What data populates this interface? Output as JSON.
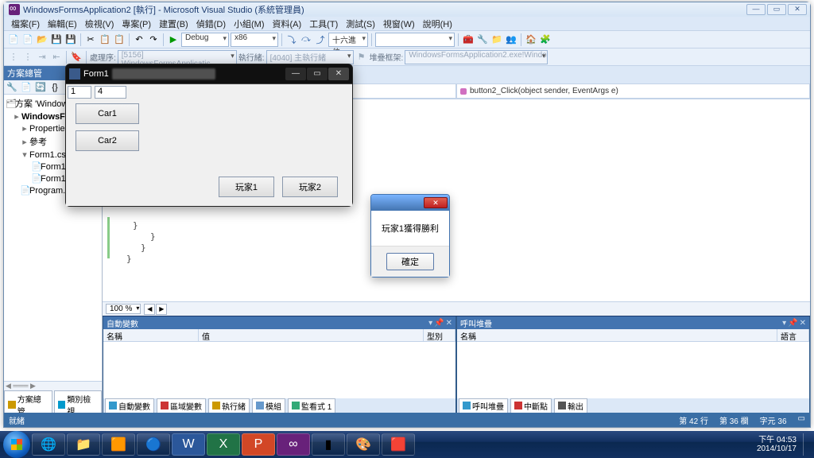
{
  "title": "WindowsFormsApplication2 [執行] - Microsoft Visual Studio (系統管理員)",
  "menu": [
    "檔案(F)",
    "編輯(E)",
    "檢視(V)",
    "專案(P)",
    "建置(B)",
    "偵錯(D)",
    "小組(M)",
    "資料(A)",
    "工具(T)",
    "測試(S)",
    "視窗(W)",
    "說明(H)"
  ],
  "toolbar": {
    "config": "Debug",
    "platform": "x86",
    "radix": "十六進位"
  },
  "toolbar2": {
    "process_label": "處理序:",
    "process_val": "[5156] WindowsFormsApplicatic",
    "thread_label": "執行緒:",
    "thread_val": "[4040] 主執行緒",
    "stack_label": "堆疊框架:",
    "stack_val": "WindowsFormsApplication2.exe!Windo"
  },
  "solution": {
    "title": "方案總管",
    "root": "方案 'WindowsF",
    "proj": "WindowsForm",
    "props": "Properties",
    "refs": "參考",
    "form": "Form1.cs",
    "form_r": "Form1.r",
    "form_i": "Form1.I",
    "program": "Program.c",
    "tab1": "方案總管",
    "tab2": "類別檢視"
  },
  "editor": {
    "left_combo": "",
    "right_combo": "button2_Click(object sender, EventArgs e)",
    "zoom": "100 %"
  },
  "debug_left": {
    "title": "自動變數",
    "col1": "名稱",
    "col2": "值",
    "col3": "型別",
    "tabs": [
      "自動變數",
      "區域變數",
      "執行緒",
      "模組",
      "監看式 1"
    ]
  },
  "debug_right": {
    "title": "呼叫堆疊",
    "col1": "名稱",
    "col2": "語言",
    "tabs": [
      "呼叫堆疊",
      "中斷點",
      "輸出"
    ]
  },
  "status": {
    "left": "就緒",
    "line": "第 42 行",
    "col": "第 36 欄",
    "ch": "字元 36"
  },
  "form1": {
    "title": "Form1",
    "t1": "1",
    "t2": "4",
    "car1": "Car1",
    "car2": "Car2",
    "p1": "玩家1",
    "p2": "玩家2"
  },
  "msgbox": {
    "text": "玩家1獲得勝利",
    "ok": "確定"
  },
  "tray": {
    "time": "下午 04:53",
    "date": "2014/10/17"
  }
}
